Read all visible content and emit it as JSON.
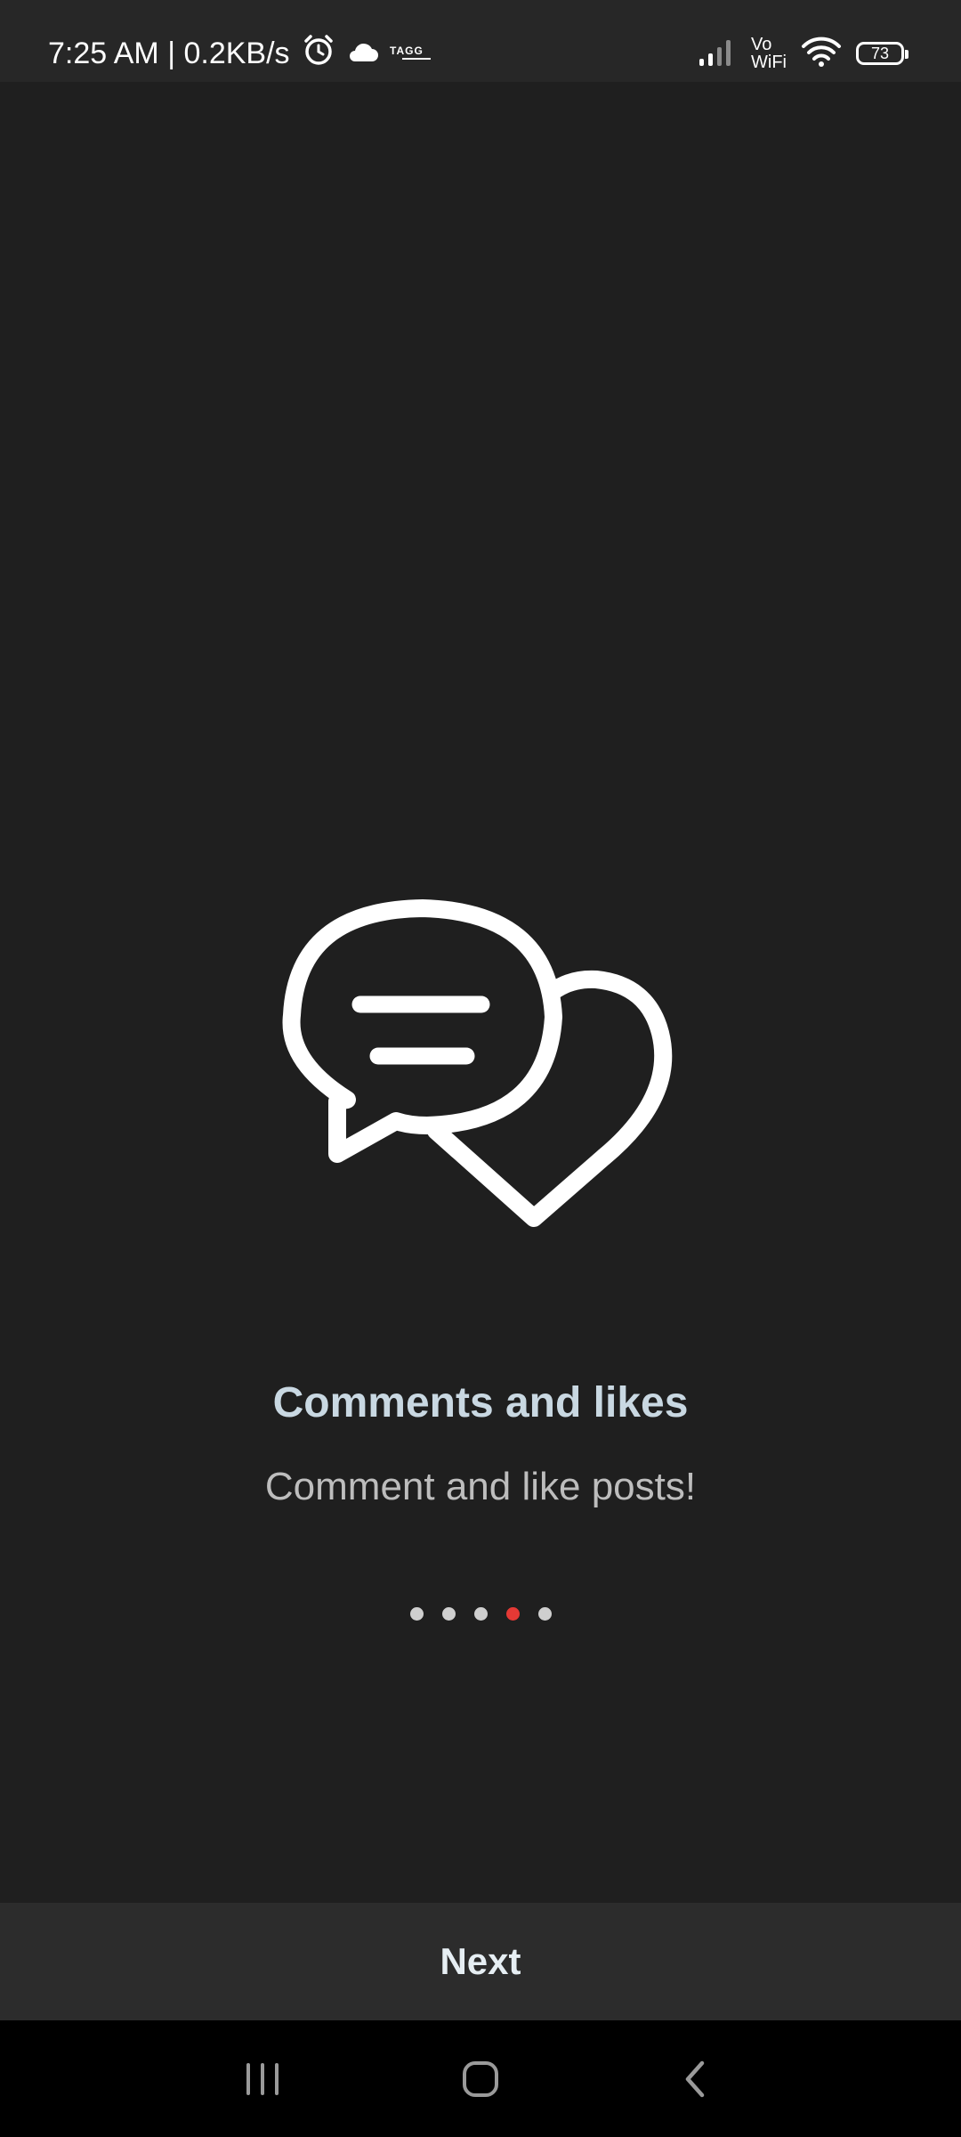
{
  "status_bar": {
    "time_speed": "7:25 AM | 0.2KB/s",
    "icons": [
      "alarm-icon",
      "cloud-icon",
      "tagg-icon",
      "signal-icon",
      "wifi-icon"
    ],
    "tagg_label": "TAGG",
    "vowifi": "Vo\nWiFi",
    "battery": "73"
  },
  "onboarding": {
    "illustration_icon": "comment-heart-icon",
    "title": "Comments and likes",
    "subtitle": "Comment and like posts!",
    "page_count": 5,
    "active_page": 4,
    "next_label": "Next"
  },
  "colors": {
    "background": "#1f1f1f",
    "title": "#c9d8e2",
    "active_dot": "#e53935",
    "inactive_dot": "#cfcfcf",
    "next_bar": "#2c2c2c"
  },
  "nav_bar": {
    "buttons": [
      "recent-apps-icon",
      "home-icon",
      "back-icon"
    ]
  }
}
